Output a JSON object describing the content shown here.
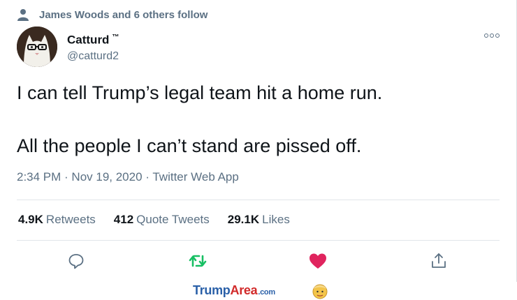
{
  "social_context": {
    "text": "James Woods and 6 others follow"
  },
  "author": {
    "name": "Catturd",
    "tm": "™",
    "handle": "@catturd2"
  },
  "tweet": {
    "text": "I can tell Trump’s legal team hit a home run.\n\nAll the people I can’t stand are pissed off.",
    "meta": "2:34 PM · Nov 19, 2020 · Twitter Web App"
  },
  "stats": {
    "retweets_count": "4.9K",
    "retweets_label": "Retweets",
    "quotes_count": "412",
    "quotes_label": "Quote Tweets",
    "likes_count": "29.1K",
    "likes_label": "Likes"
  },
  "actions": [
    "reply-icon",
    "retweet-icon",
    "like-icon",
    "share-icon"
  ],
  "watermark": {
    "part1": "Trump",
    "part2": "Area",
    "part3": ".com"
  },
  "colors": {
    "muted": "#5b7083",
    "retweet_green": "#17bf63",
    "like_red": "#e0245e",
    "brand_blue": "#2a60a8",
    "brand_red": "#d12a2a"
  }
}
